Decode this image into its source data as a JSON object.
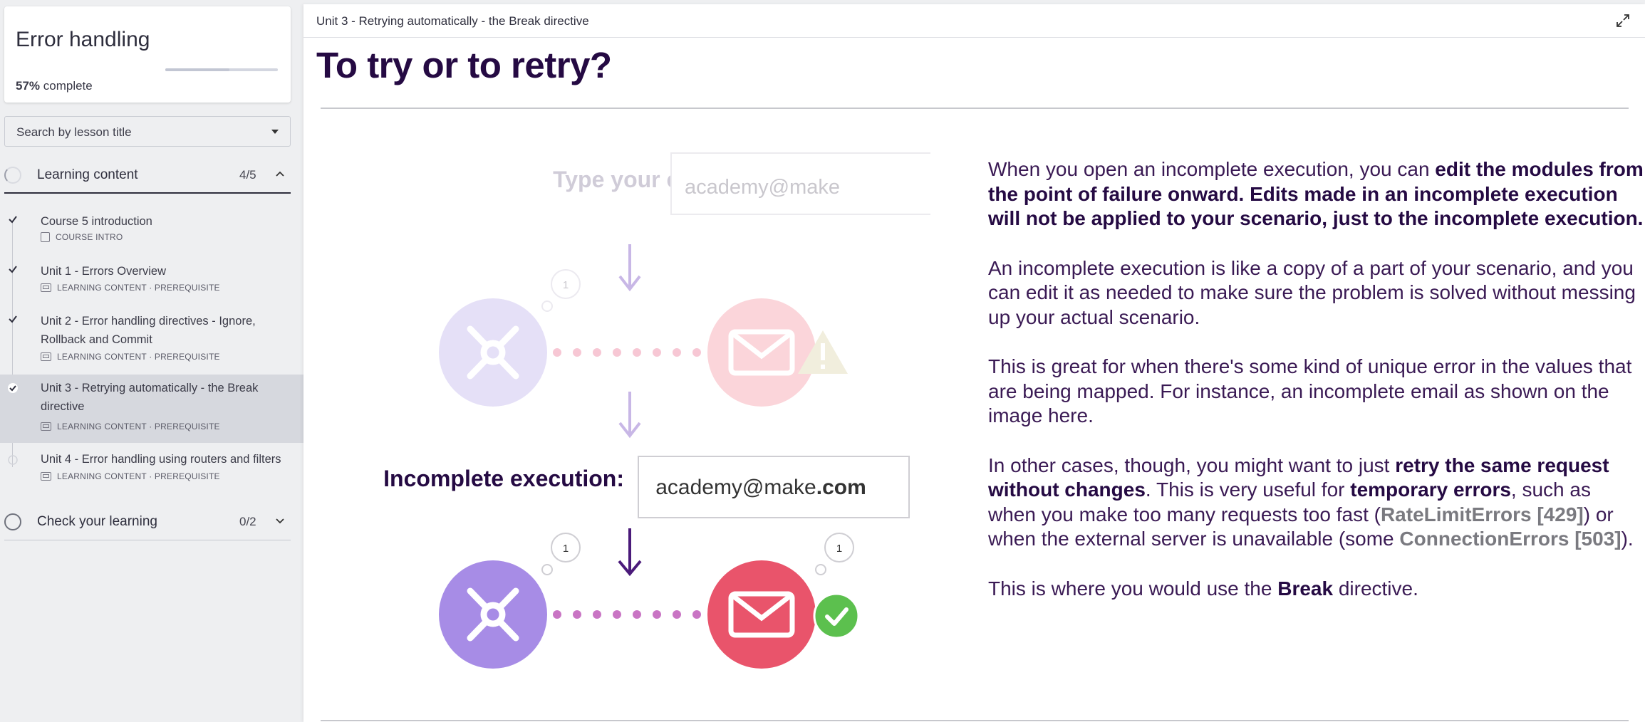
{
  "sidebar": {
    "course_title": "Error handling",
    "progress_percent": "57%",
    "progress_suffix": " complete",
    "progress_fraction": 0.57,
    "search_placeholder": "Search by lesson title",
    "sections": [
      {
        "label": "Learning content",
        "count": "4/5"
      },
      {
        "label": "Check your learning",
        "count": "0/2"
      }
    ],
    "lessons": [
      {
        "title": "Course 5 introduction",
        "meta": "COURSE INTRO",
        "completed": true
      },
      {
        "title": "Unit 1 - Errors Overview",
        "meta": "LEARNING CONTENT · PREREQUISITE",
        "completed": true
      },
      {
        "title": "Unit 2 - Error handling directives - Ignore, Rollback and Commit",
        "meta": "LEARNING CONTENT · PREREQUISITE",
        "completed": true
      },
      {
        "title": "Unit 3 - Retrying automatically - the Break directive",
        "meta": "LEARNING CONTENT · PREREQUISITE",
        "completed": true,
        "active": true
      },
      {
        "title": "Unit 4 - Error handling using routers and filters",
        "meta": "LEARNING CONTENT · PREREQUISITE",
        "completed": false
      }
    ]
  },
  "main": {
    "unit_title": "Unit 3 - Retrying automatically - the Break directive",
    "page_title": "To try or to retry?",
    "diagram": {
      "top_label": "Type your email:",
      "top_value": "academy@make",
      "bottom_label": "Incomplete execution:",
      "bottom_value_plain": "academy@make",
      "bottom_value_bold": ".com",
      "bubble_count": "1"
    },
    "paragraphs": {
      "p1_a": "When you open an incomplete execution, you can ",
      "p1_b": "edit the modules from the point of failure onward. Edits made in an incomplete execution will not be applied to your scenario, just to the incomplete execution.",
      "p2": "An incomplete execution is like a copy of a part of your scenario, and you can edit it as needed to make sure the problem is solved without messing up your actual scenario.",
      "p3": "This is great for when there's some kind of unique error in the values that are being mapped. For instance, an incomplete email as shown on the image here.",
      "p4_a": "In other cases, though, you might want to just ",
      "p4_b": "retry the same request without changes",
      "p4_c": ". This is very useful for ",
      "p4_d": "temporary errors",
      "p4_e": ", such as when you make too many requests too fast (",
      "p4_f": "RateLimitErrors [429]",
      "p4_g": ") or when the external server is unavailable (some ",
      "p4_h": "ConnectionErrors [503]",
      "p4_i": ").",
      "p5_a": "This is where you would use the ",
      "p5_b": "Break",
      "p5_c": " directive."
    }
  },
  "colors": {
    "title": "#250a43",
    "tools_faded": "#e5e0f7",
    "tools": "#a78ce6",
    "mail_faded": "#fbd5da",
    "mail": "#e9546b",
    "check": "#5cc04e",
    "warning_faded": "#f1eedd",
    "arrow_faded": "#c8b7e6",
    "arrow": "#4a1a7a"
  }
}
